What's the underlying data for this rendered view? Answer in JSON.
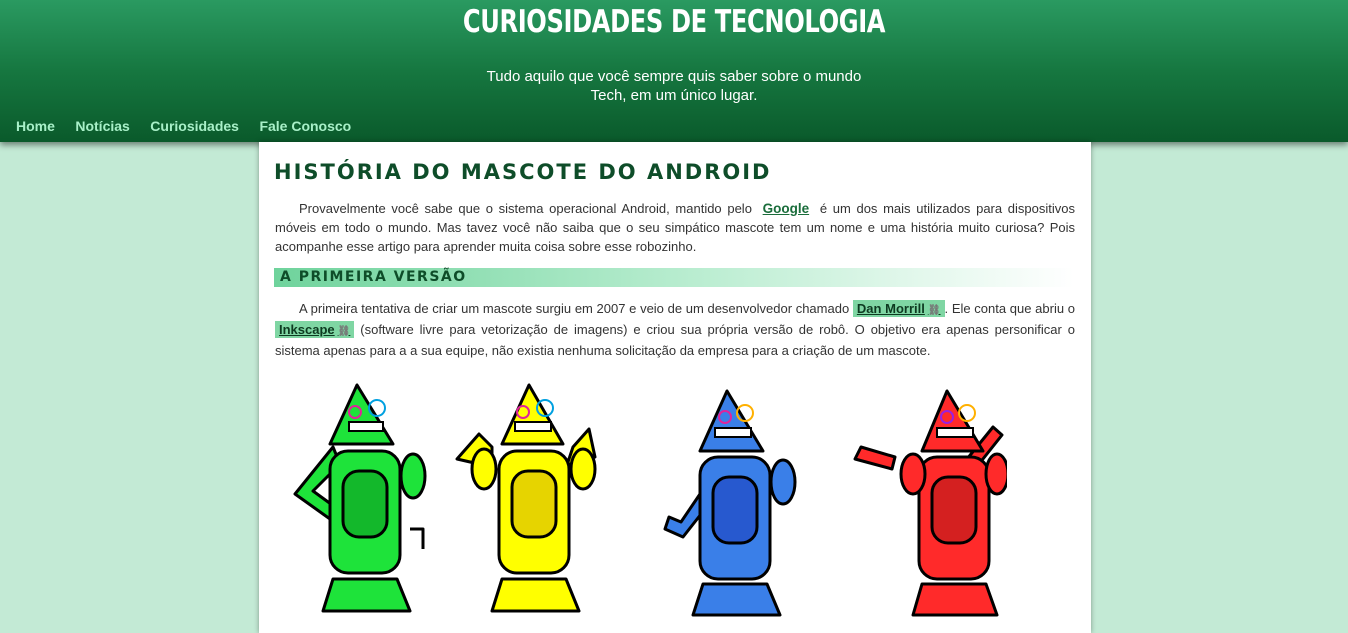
{
  "site": {
    "title": "CURIOSIDADES DE TECNOLOGIA",
    "subtitle": "Tudo aquilo que você sempre quis saber sobre o mundo Tech, em um único lugar."
  },
  "nav": {
    "items": [
      "Home",
      "Notícias",
      "Curiosidades",
      "Fale Conosco"
    ]
  },
  "article": {
    "title": "HISTÓRIA DO MASCOTE DO ANDROID",
    "p1": {
      "before": "Provavelmente você sabe que o sistema operacional Android, mantido pelo",
      "link": "Google",
      "after": "é um dos mais utilizados para dispositivos móveis em todo o mundo. Mas tavez você não saiba que o seu simpático mascote tem um nome e uma história muito curiosa? Pois acompanhe esse artigo para aprender muita coisa sobre esse robozinho."
    },
    "section_title": "A PRIMEIRA VERSÃO",
    "p2": {
      "before": "A primeira tentativa de criar um mascote surgiu em 2007 e veio de um desenvolvedor chamado",
      "link1": "Dan Morrill",
      "middle": ". Ele conta que abriu o",
      "link2": "Inkscape",
      "after": "(software livre para vetorização de imagens) e criou sua própria versão de robô. O objetivo era apenas personificar o sistema apenas para a a sua equipe, não existia nenhuma solicitação da empresa para a criação de um mascote."
    }
  },
  "colors": {
    "header_dark": "#0a5a2b",
    "header_light": "#2a9a61",
    "page_bg": "#c3ead5",
    "nav_link": "#a8f0c8",
    "link_highlight": "#7fd6a3",
    "robot_colors": [
      "#1ee33a",
      "#ffff00",
      "#3a7fe8",
      "#ff2a2a"
    ]
  },
  "icons": {
    "external_link": "link-icon"
  }
}
